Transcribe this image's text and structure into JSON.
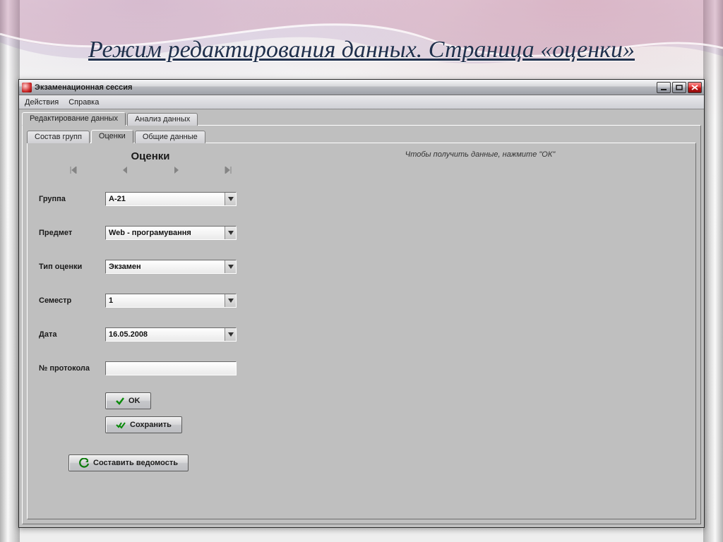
{
  "slide": {
    "title": "Режим редактирования данных. Страница «оценки»"
  },
  "window": {
    "title": "Экзаменационная сессия"
  },
  "menu": {
    "actions": "Действия",
    "help": "Справка"
  },
  "tabs_outer": {
    "edit": "Редактирование данных",
    "analysis": "Анализ данных"
  },
  "tabs_inner": {
    "groups": "Состав групп",
    "grades": "Оценки",
    "common": "Общие данные"
  },
  "form": {
    "heading": "Оценки",
    "labels": {
      "group": "Группа",
      "subject": "Предмет",
      "grade_type": "Тип оценки",
      "semester": "Семестр",
      "date": "Дата",
      "protocol_no": "№ протокола"
    },
    "values": {
      "group": "А-21",
      "subject": "Web - програмування",
      "grade_type": "Экзамен",
      "semester": "1",
      "date": "16.05.2008",
      "protocol_no": ""
    }
  },
  "buttons": {
    "ok": "OK",
    "save": "Сохранить",
    "compose": "Составить ведомость"
  },
  "hint": "Чтобы получить данные, нажмите \"ОК\""
}
